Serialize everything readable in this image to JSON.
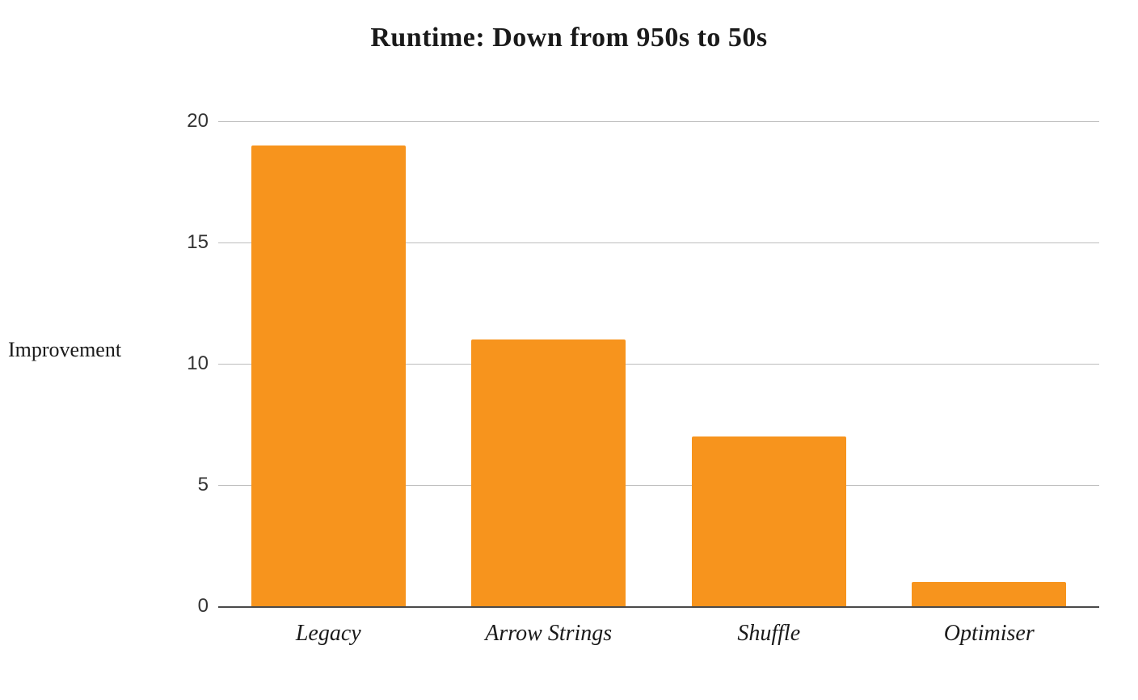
{
  "chart_data": {
    "type": "bar",
    "title": "Runtime: Down from 950s to 50s",
    "categories": [
      "Legacy",
      "Arrow Strings",
      "Shuffle",
      "Optimiser"
    ],
    "values": [
      19,
      11,
      7,
      1
    ],
    "ylabel": "Improvement",
    "xlabel": "",
    "ylim": [
      0,
      20
    ],
    "yticks": [
      0,
      5,
      10,
      15,
      20
    ],
    "bar_color": "#f7941d"
  }
}
